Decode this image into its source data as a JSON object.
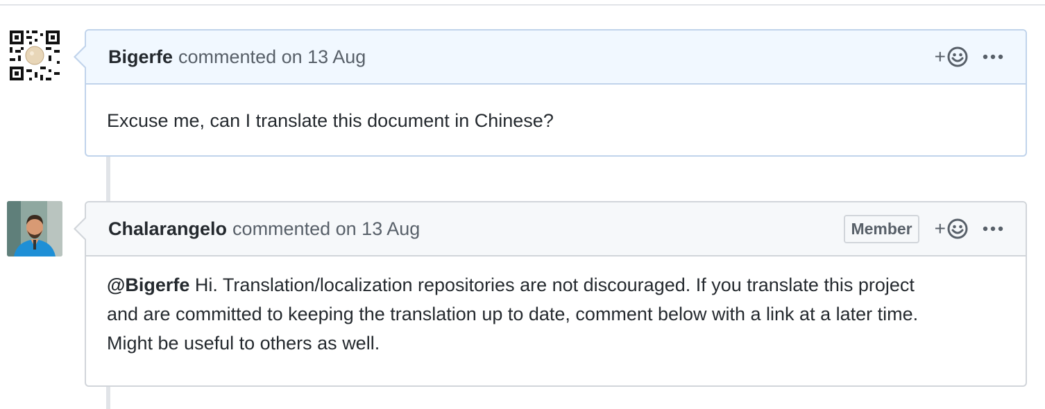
{
  "comments": [
    {
      "author": "Bigerfe",
      "meta_prefix": "commented on",
      "date": "13 Aug",
      "body": "Excuse me, can I translate this document in Chinese?",
      "avatar_icon": "qr-code-avatar",
      "reaction_plus": "+",
      "more_icon": "kebab-horizontal-icon",
      "accent": "#f1f8ff",
      "border": "#c0d3eb"
    },
    {
      "author": "Chalarangelo",
      "meta_prefix": "commented on",
      "date": "13 Aug",
      "badge": "Member",
      "mention": "@Bigerfe",
      "body_line1": " Hi. Translation/localization repositories are not discouraged. If you translate this project",
      "body_line2": "and are committed to keeping the translation up to date, comment below with a link at a later time.",
      "body_line3": "Might be useful to others as well.",
      "avatar_icon": "profile-photo-avatar",
      "reaction_plus": "+",
      "more_icon": "kebab-horizontal-icon",
      "accent": "#f6f8fa",
      "border": "#d1d5da"
    }
  ]
}
